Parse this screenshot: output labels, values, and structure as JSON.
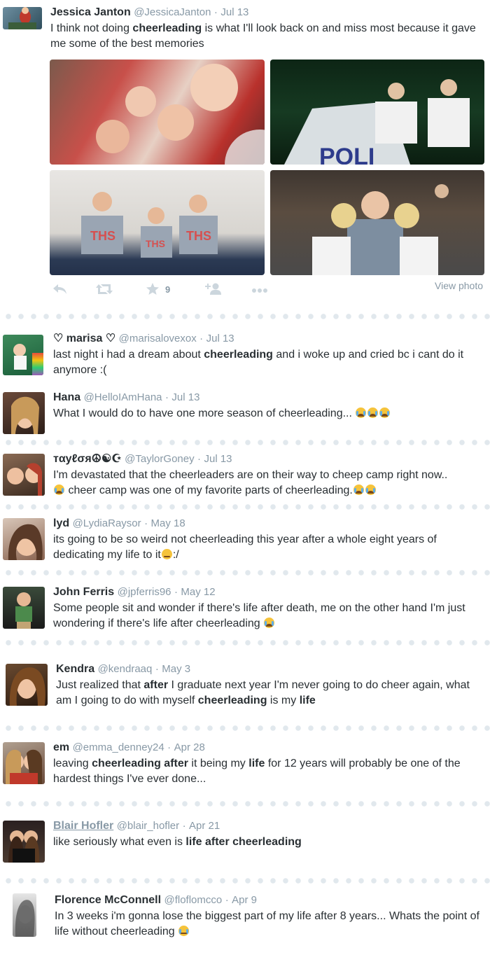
{
  "tweets": [
    {
      "name": "Jessica Janton",
      "handle": "@JessicaJanton",
      "time": "Jul 13",
      "text_parts": [
        "I think not doing ",
        "cheerleading",
        " is what I'll look back on and miss most because it gave me some of the best memories"
      ],
      "favorites": "9",
      "view_photo": "View photo"
    },
    {
      "name": "♡ marisa ♡",
      "handle": "@marisalovexox",
      "time": "Jul 13",
      "text_parts": [
        "last night i had a dream about ",
        "cheerleading",
        " and i woke up and cried bc i cant do it anymore :("
      ]
    },
    {
      "name": "Hana",
      "handle": "@HelloIAmHana",
      "time": "Jul 13",
      "text_parts": [
        "What I would do to have one more season of cheerleading..."
      ]
    },
    {
      "name": "тαуℓσя☮☯☪",
      "handle": "@TaylorGoney",
      "time": "Jul 13",
      "text_parts": [
        "I'm devastated that the cheerleaders are on their way to cheep camp right now..",
        " cheer camp was one of my favorite parts of cheerleading."
      ]
    },
    {
      "name": "lyd",
      "handle": "@LydiaRaysor",
      "time": "May 18",
      "text_parts": [
        "its going to be so weird not cheerleading this year after a whole eight years of dedicating my life to it",
        ":/"
      ]
    },
    {
      "name": "John Ferris",
      "handle": "@jpferris96",
      "time": "May 12",
      "text_parts": [
        "Some people sit and wonder if there's life after death, me on the other hand I'm just wondering if there's life after cheerleading"
      ]
    },
    {
      "name": "Kendra",
      "handle": "@kendraaq",
      "time": "May 3",
      "text_parts": [
        "Just realized that ",
        "after",
        " I graduate next year I'm never going to do cheer again, what am I going to do with myself ",
        "cheerleading",
        " is my ",
        "life"
      ]
    },
    {
      "name": "em",
      "handle": "@emma_denney24",
      "time": "Apr 28",
      "text_parts": [
        "leaving ",
        "cheerleading after",
        " it being my ",
        "life",
        " for 12 years will probably be one of the hardest things I've ever done..."
      ]
    },
    {
      "name": "Blair Hofler",
      "handle": "@blair_hofler",
      "time": "Apr 21",
      "text_parts": [
        "like seriously what even is ",
        "life after cheerleading"
      ]
    },
    {
      "name": "Florence McConnell",
      "handle": "@floflomcco",
      "time": "Apr 9",
      "text_parts": [
        "In 3 weeks i'm gonna lose the biggest part of my life after 8 years... Whats the point of life without cheerleading"
      ]
    }
  ],
  "photo_labels": [
    "THS",
    "THS",
    "THS",
    "POLI"
  ],
  "colors": {
    "accent": "#8899a6",
    "text": "#292f33",
    "divider": "#e1e8ed",
    "icon": "#ccd6dd"
  },
  "icons": [
    "reply-icon",
    "retweet-icon",
    "favorite-icon",
    "follow-icon",
    "more-icon",
    "crying-emoji",
    "persevering-emoji",
    "sad-emoji"
  ]
}
